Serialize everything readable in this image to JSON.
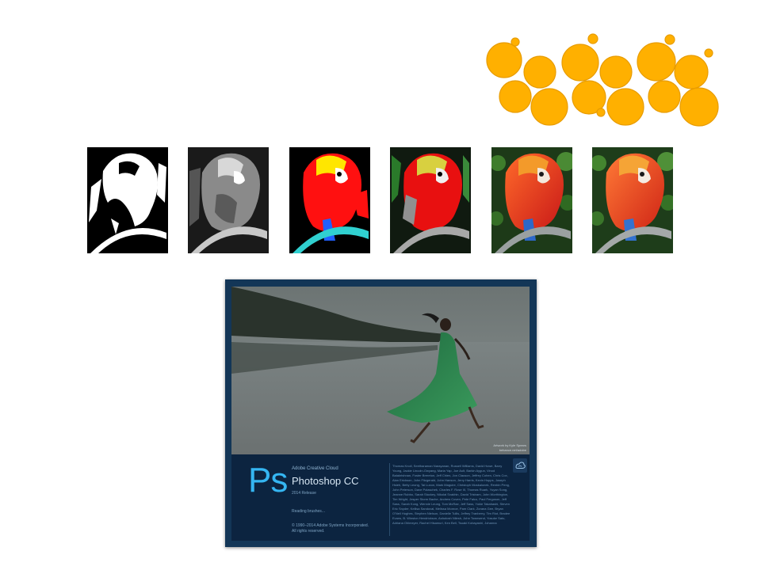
{
  "splash": {
    "logo_text": "Ps",
    "suite": "Adobe Creative Cloud",
    "product": "Photoshop CC",
    "release": "2014 Release",
    "status": "Reading brushes...",
    "copyright": "© 1990–2014 Adobe Systems Incorporated.",
    "rights": "All rights reserved.",
    "artwork_credit_line1": "Artwork by Kyle Spears",
    "artwork_credit_line2": "behance.net/adobe",
    "credits": "Thomas Knoll, Seetharaman Narayanan, Russell Williams, David Howe, Barry Young, Jackie Lincoln-Owyang, Maria Yap, Joe Ault, Barkin Aygun, Vinod Balakrishnan, Foster Brereton, Jeff Chien, Jon Clauson, Jeffrey Cohen, Chris Cox, Alan Erickson, John Fitzgerald, John Hanson, Jerry Harris, Kevin Hopps, Joseph Hsieh, Betty Leong, Tai Luxon, Mark Maguire, Christoph Moskalonek, Renbin Peng, John Peterson, Dave Polaschek, Charles F. Rose III, Thomas Ruark, Yuyan Song, Jeanne Rubbo, Sarah Stuckey, Nikolai Svakhin, David Tristram, John Worthington, Tim Wright, Jesper Storm Bache, Andrew Coven, Pete Falco, Paul Ferguson, Jeff Sass, Sarah Kong, Wennie Leung, Tom McRae, Jeff Sass, Yukie Takahashi, Steven Eric Snyder, Kellisa Sandoval, Melissa Monroe, Pam Clark, Zorana Gee, Bryan O'Neil Hughes, Stephen Nielson, Danielle Tullis, Jeffrey Tranberry, Tim Riot, Bradee Evans, B. Winston Hendrickson, Ashutosh Nilesh, John Townsend, Yosuke Sato, Adriana Ohlmeyer, Rachel Hisamuri, Ken Bell, Tsuaki Kobayashi, Johanna"
  },
  "colors": {
    "ps_blue": "#35b6f2",
    "splash_frame": "#133657",
    "splash_panel": "#0c2440",
    "orange_dots": "#ffb000"
  },
  "thumbnails": [
    "1-bit black & white",
    "grayscale levels",
    "posterized 4-color",
    "posterized 8-color",
    "high color",
    "full color"
  ]
}
